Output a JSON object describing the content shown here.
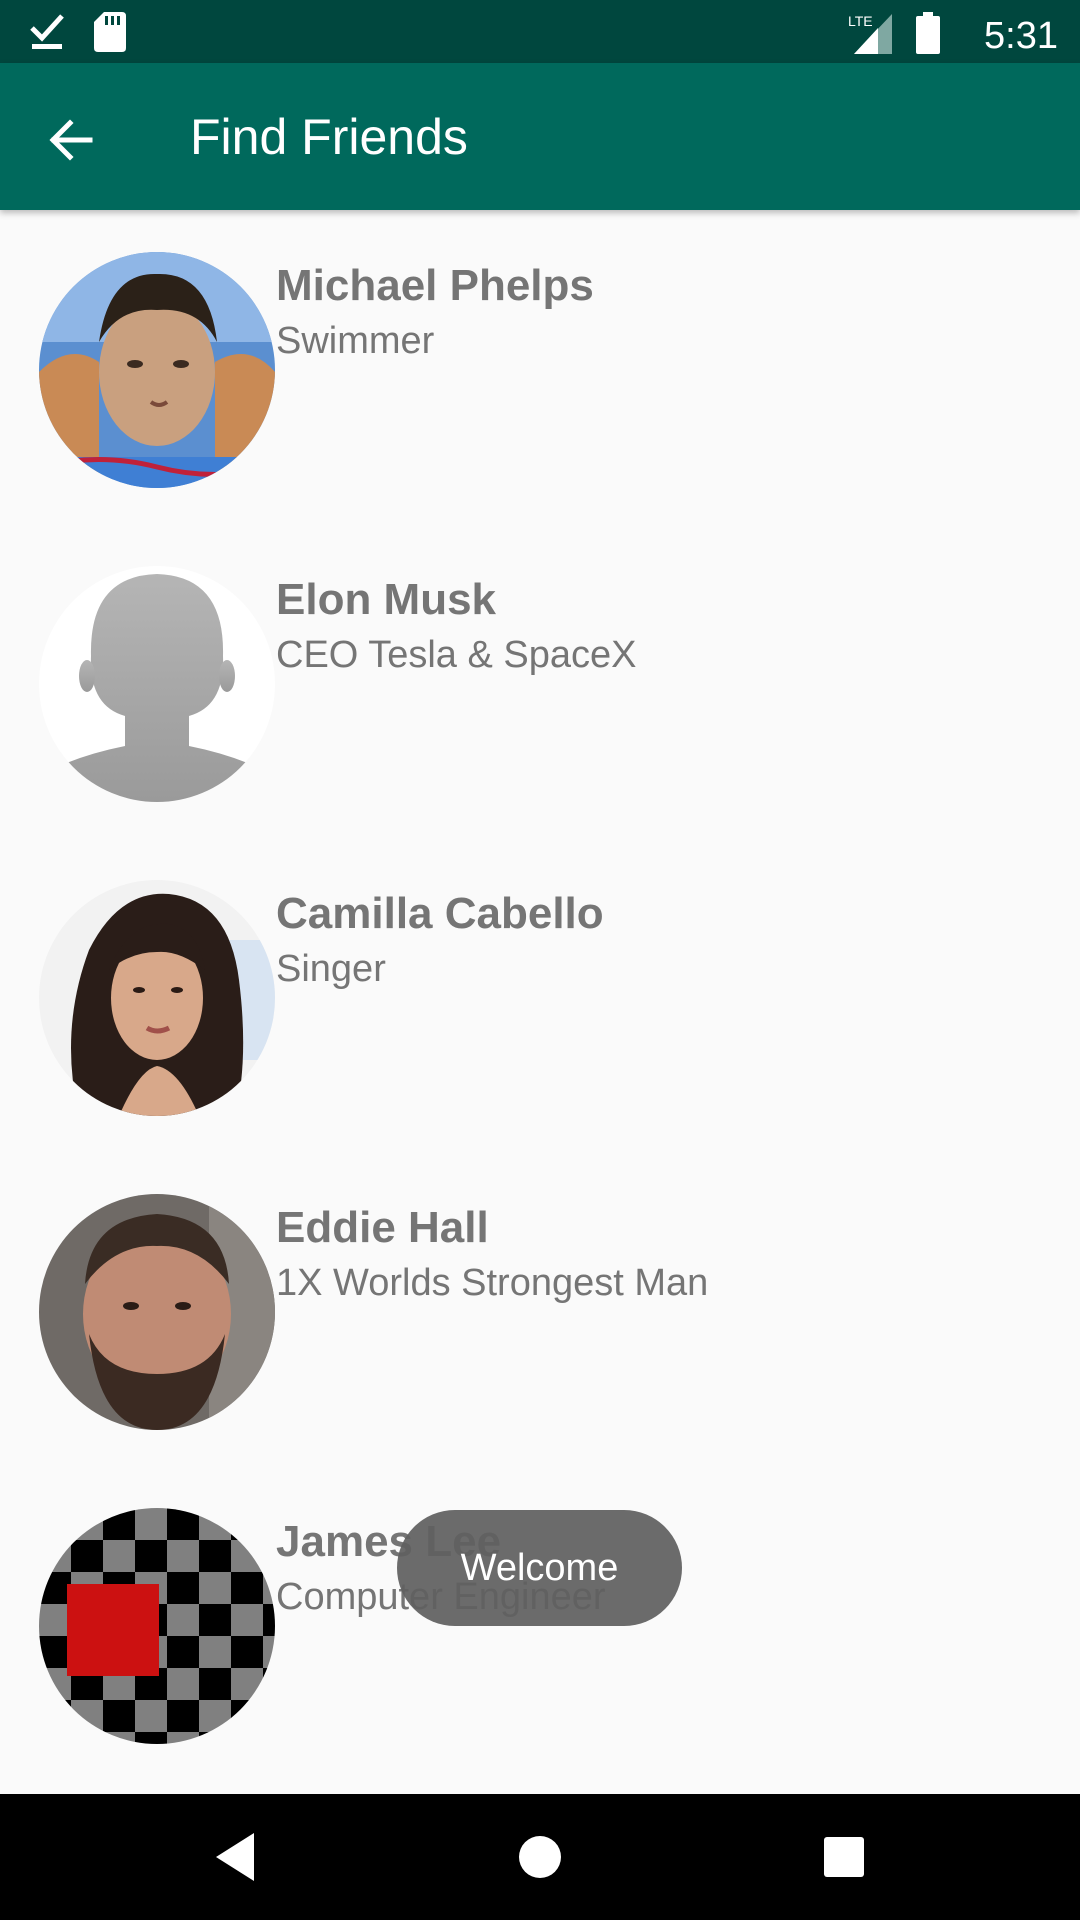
{
  "status_bar": {
    "time": "5:31",
    "network": "LTE",
    "icons": [
      "download-done-icon",
      "sd-card-icon",
      "lte-signal-icon",
      "battery-icon"
    ]
  },
  "app_bar": {
    "title": "Find Friends",
    "back_icon": "arrow-back-icon"
  },
  "friends": [
    {
      "name": "Michael Phelps",
      "description": "Swimmer"
    },
    {
      "name": "Elon Musk",
      "description": "CEO Tesla & SpaceX"
    },
    {
      "name": "Camilla Cabello",
      "description": "Singer"
    },
    {
      "name": "Eddie Hall",
      "description": "1X Worlds Strongest Man"
    },
    {
      "name": "James Lee",
      "description": "Computer Engineer"
    }
  ],
  "toast": {
    "text": "Welcome"
  },
  "nav_bar": {
    "buttons": [
      "back-triangle-icon",
      "home-circle-icon",
      "recents-square-icon"
    ]
  },
  "colors": {
    "status_bar": "#00473e",
    "app_bar": "#00695c",
    "background": "#fafafa",
    "text": "#757575",
    "toast": "#606060"
  }
}
